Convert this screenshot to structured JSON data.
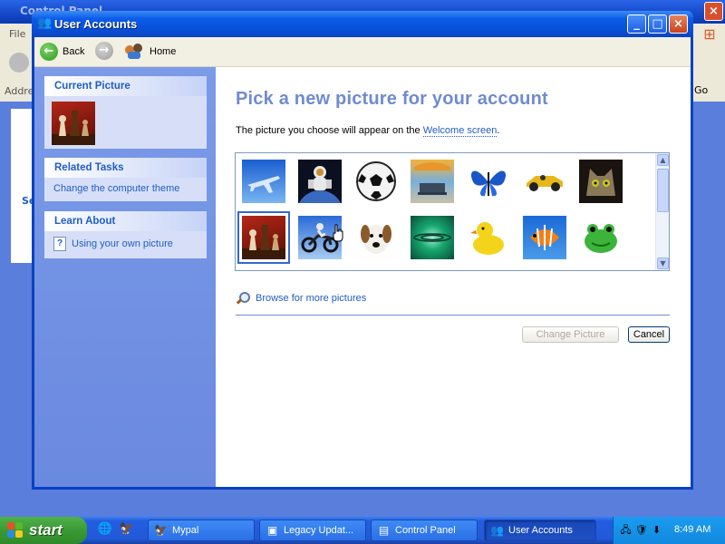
{
  "background_window": {
    "title": "Control Panel",
    "menu_file": "File",
    "address_label": "Address",
    "go_label": "Go",
    "side_text": "Se"
  },
  "window": {
    "title": "User Accounts",
    "controls": {
      "minimize": "_",
      "maximize": "□",
      "close": "×"
    }
  },
  "navbar": {
    "back_label": "Back",
    "home_label": "Home"
  },
  "left_pane": {
    "current_picture": {
      "heading": "Current Picture"
    },
    "related_tasks": {
      "heading": "Related Tasks",
      "items": [
        "Change the computer theme"
      ]
    },
    "learn_about": {
      "heading": "Learn About",
      "items": [
        "Using your own picture"
      ]
    }
  },
  "main": {
    "heading": "Pick a new picture for your account",
    "subtitle_prefix": "The picture you choose will appear on the ",
    "subtitle_link": "Welcome screen",
    "subtitle_suffix": ".",
    "pictures": [
      {
        "name": "airplane",
        "selected": false
      },
      {
        "name": "astronaut",
        "selected": false
      },
      {
        "name": "soccer-ball",
        "selected": false
      },
      {
        "name": "beach-chairs",
        "selected": false
      },
      {
        "name": "butterfly",
        "selected": false
      },
      {
        "name": "race-car",
        "selected": false
      },
      {
        "name": "cat",
        "selected": false
      },
      {
        "name": "chess",
        "selected": true
      },
      {
        "name": "dirt-bike",
        "selected": false
      },
      {
        "name": "dog",
        "selected": false
      },
      {
        "name": "drip",
        "selected": false
      },
      {
        "name": "duck",
        "selected": false
      },
      {
        "name": "fish",
        "selected": false
      },
      {
        "name": "frog",
        "selected": false
      }
    ],
    "browse_label": "Browse for more pictures",
    "change_button": "Change Picture",
    "cancel_button": "Cancel"
  },
  "taskbar": {
    "start_label": "start",
    "tasks": [
      {
        "label": "Mypal",
        "active": false
      },
      {
        "label": "Legacy Updat...",
        "active": false
      },
      {
        "label": "Control Panel",
        "active": false
      },
      {
        "label": "User Accounts",
        "active": true
      }
    ],
    "clock": "8:49 AM"
  },
  "colors": {
    "accent": "#215dc6",
    "heading": "#6f8bd0",
    "taskbar": "#245de0",
    "start": "#3a9a34"
  }
}
